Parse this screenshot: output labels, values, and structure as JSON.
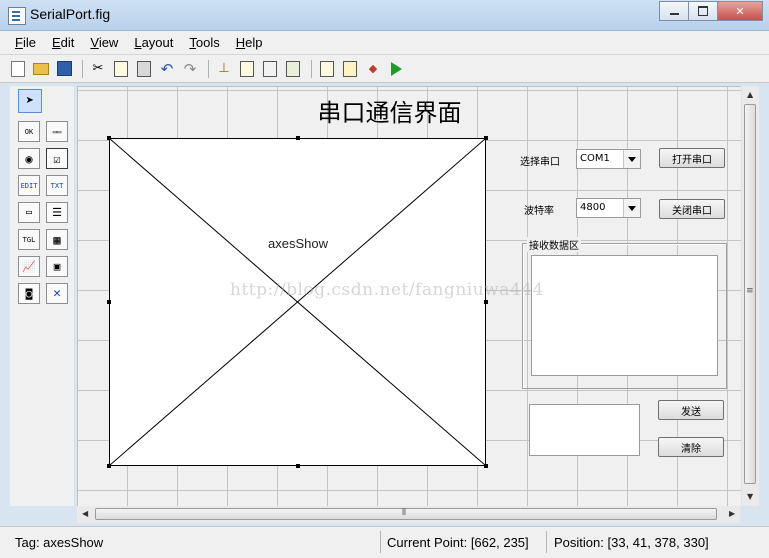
{
  "window": {
    "title": "SerialPort.fig"
  },
  "menu": [
    {
      "first": "F",
      "rest": "ile"
    },
    {
      "first": "E",
      "rest": "dit"
    },
    {
      "first": "V",
      "rest": "iew"
    },
    {
      "first": "L",
      "rest": "ayout"
    },
    {
      "first": "T",
      "rest": "ools"
    },
    {
      "first": "H",
      "rest": "elp"
    }
  ],
  "gui": {
    "title": "串口通信界面",
    "axes_label": "axesShow",
    "port_label": "选择串口",
    "port_value": "COM1",
    "baud_label": "波特率",
    "baud_value": "4800",
    "open_button": "打开串口",
    "close_button": "关闭串口",
    "receive_panel_title": "接收数据区",
    "send_button": "发送",
    "clear_button": "清除"
  },
  "watermark": "http://blog.csdn.net/fangniuwa444",
  "status": {
    "tag": "Tag: axesShow",
    "current_point": "Current Point:  [662, 235]",
    "position": "Position: [33, 41, 378, 330]"
  },
  "palette_labels": {
    "pushbutton": "OK",
    "slider": "▭▭",
    "edit": "EDIT",
    "text": "TXT",
    "toggle": "TGL"
  },
  "colors": {
    "accent": "#1e9c2a",
    "titlebar": "#b9d1ec",
    "close": "#c75050"
  }
}
